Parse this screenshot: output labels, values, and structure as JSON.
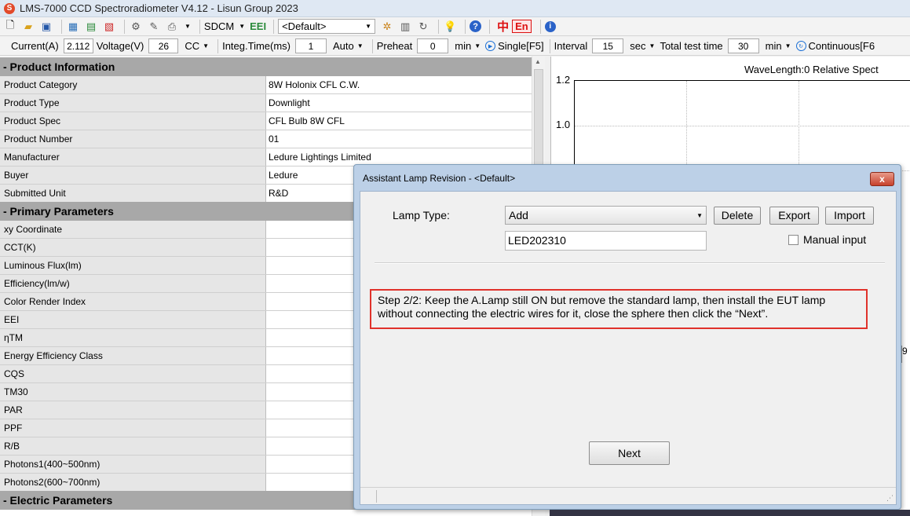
{
  "window": {
    "title": "LMS-7000 CCD Spectroradiometer V4.12 - Lisun Group 2023",
    "app_icon": "S"
  },
  "toolbar1": {
    "sdcm_label": "SDCM",
    "eei_label": "EEI",
    "profile_value": "<Default>",
    "lang_cn": "中",
    "lang_en": "En"
  },
  "toolbar2": {
    "current_label": "Current(A)",
    "current_value": "2.112",
    "voltage_label": "Voltage(V)",
    "voltage_value": "26",
    "mode_value": "CC",
    "integ_label": "Integ.Time(ms)",
    "integ_value": "1",
    "integ_mode": "Auto",
    "preheat_label": "Preheat",
    "preheat_value": "0",
    "preheat_unit": "min",
    "single_label": "Single[F5]",
    "interval_label": "Interval",
    "interval_value": "15",
    "interval_unit": "sec",
    "total_label": "Total test time",
    "total_value": "30",
    "total_unit": "min",
    "continuous_label": "Continuous[F6"
  },
  "sections": {
    "product": {
      "title": "- Product Information",
      "rows": [
        {
          "label": "Product Category",
          "value": "8W Holonix CFL C.W."
        },
        {
          "label": "Product Type",
          "value": "Downlight"
        },
        {
          "label": "Product Spec",
          "value": "CFL Bulb  8W CFL"
        },
        {
          "label": "Product Number",
          "value": "01"
        },
        {
          "label": "Manufacturer",
          "value": "Ledure Lightings Limited"
        },
        {
          "label": "Buyer",
          "value": "Ledure"
        },
        {
          "label": "Submitted Unit",
          "value": "R&D"
        }
      ]
    },
    "primary": {
      "title": "- Primary Parameters",
      "rows": [
        {
          "label": "xy Coordinate",
          "value": ""
        },
        {
          "label": "CCT(K)",
          "value": ""
        },
        {
          "label": "Luminous Flux(lm)",
          "value": ""
        },
        {
          "label": "Efficiency(lm/w)",
          "value": ""
        },
        {
          "label": "Color Render Index",
          "value": ""
        },
        {
          "label": "EEI",
          "value": ""
        },
        {
          "label": "ηTM",
          "value": ""
        },
        {
          "label": "Energy Efficiency Class",
          "value": ""
        },
        {
          "label": "CQS",
          "value": ""
        },
        {
          "label": "TM30",
          "value": ""
        },
        {
          "label": "PAR",
          "value": ""
        },
        {
          "label": "PPF",
          "value": ""
        },
        {
          "label": "R/B",
          "value": ""
        },
        {
          "label": "Photons1(400~500nm)",
          "value": ""
        },
        {
          "label": "Photons2(600~700nm)",
          "value": ""
        }
      ]
    },
    "electric": {
      "title": "- Electric Parameters"
    }
  },
  "chart": {
    "readout": "WaveLength:0    Relative Spect",
    "yticks": [
      "1.2",
      "1.0"
    ]
  },
  "dialog": {
    "title": "Assistant Lamp Revision - <Default>",
    "close_label": "x",
    "lamp_type_label": "Lamp Type:",
    "lamp_type_value": "Add",
    "delete_label": "Delete",
    "export_label": "Export",
    "import_label": "Import",
    "lamp_name_value": "LED202310",
    "manual_input_label": "Manual input",
    "step_text": "Step 2/2: Keep the A.Lamp still ON but remove the standard lamp, then install the EUT lamp without connecting the electric wires for it, close the sphere then click the “Next”.",
    "next_label": "Next"
  }
}
